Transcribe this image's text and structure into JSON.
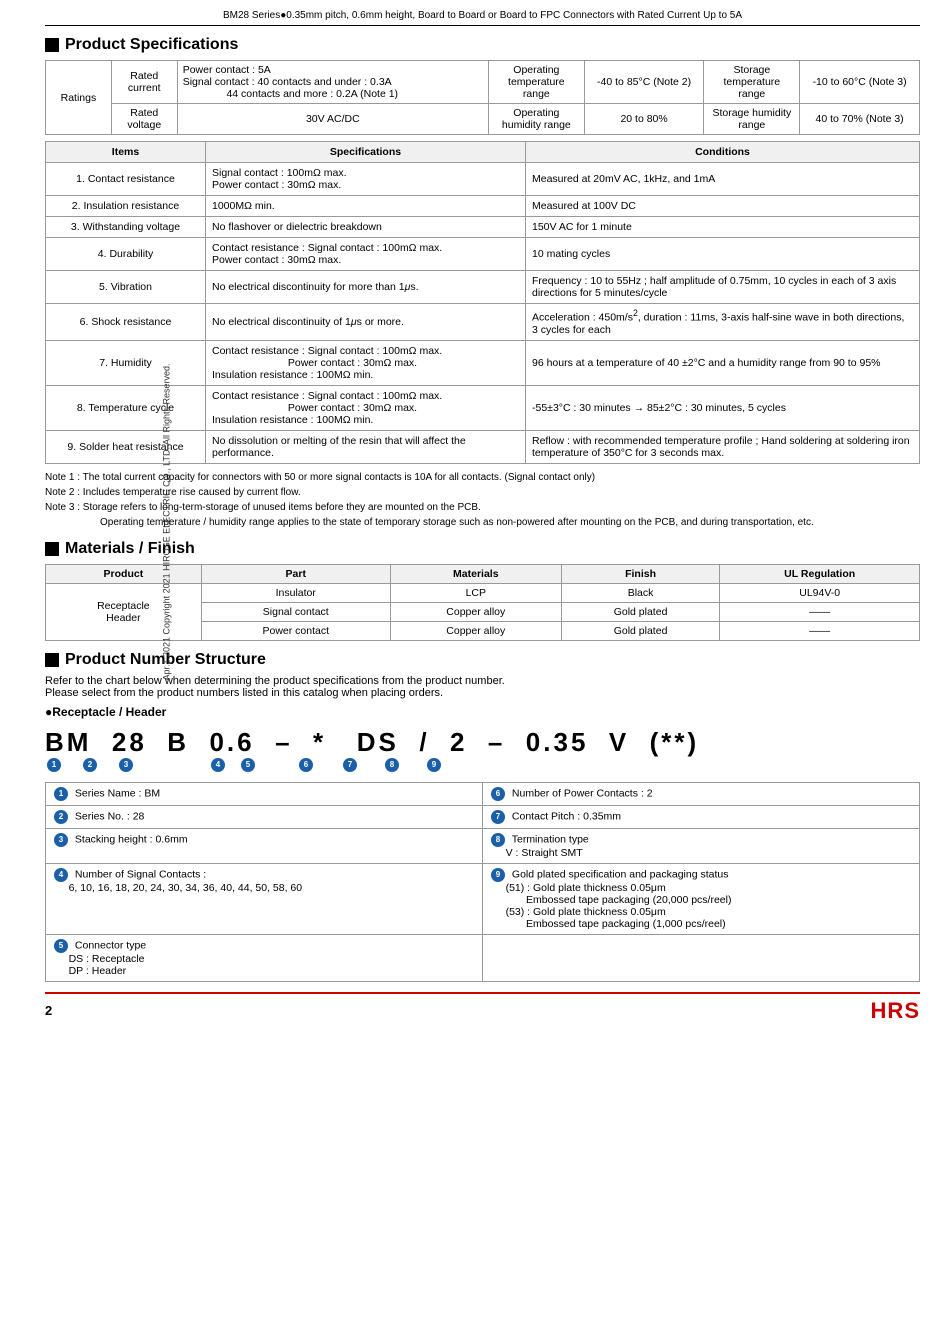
{
  "header": {
    "title": "BM28 Series●0.35mm pitch, 0.6mm height, Board to Board or Board to FPC Connectors with Rated Current Up to 5A"
  },
  "side_text": "Apr.1.2021 Copyright 2021 HIROSE ELECTRIC CO., LTD. All Rights Reserved.",
  "product_specs": {
    "title": "Product Specifications",
    "ratings_table": {
      "headers": [
        "Ratings",
        "Rated current",
        "Power contact : 5A / Signal contact : 40 contacts and under : 0.3A / 44 contacts and more : 0.2A (Note 1)",
        "Operating temperature range",
        "-40 to 85°C (Note 2)",
        "Storage temperature range",
        "-10 to 60°C (Note 3)"
      ],
      "row2": [
        "",
        "Rated voltage",
        "30V AC/DC",
        "Operating humidity range",
        "20 to 80%",
        "Storage humidity range",
        "40 to 70% (Note 3)"
      ]
    },
    "main_table": {
      "col_headers": [
        "Items",
        "Specifications",
        "Conditions"
      ],
      "rows": [
        {
          "item": "1. Contact resistance",
          "spec": "Signal contact : 100mΩ max.\nPower contact : 30mΩ max.",
          "cond": "Measured at 20mV AC, 1kHz, and 1mA"
        },
        {
          "item": "2. Insulation resistance",
          "spec": "1000MΩ min.",
          "cond": "Measured at 100V DC"
        },
        {
          "item": "3. Withstanding voltage",
          "spec": "No flashover or dielectric breakdown",
          "cond": "150V AC for 1 minute"
        },
        {
          "item": "4. Durability",
          "spec": "Contact resistance : Signal contact : 100mΩ max.\nPower contact : 30mΩ max.",
          "cond": "10 mating cycles"
        },
        {
          "item": "5. Vibration",
          "spec": "No electrical discontinuity for more than 1μs.",
          "cond": "Frequency : 10 to 55Hz ; half amplitude of 0.75mm, 10 cycles in each of 3 axis directions for 5 minutes/cycle"
        },
        {
          "item": "6. Shock resistance",
          "spec": "No electrical discontinuity of 1μs or more.",
          "cond": "Acceleration : 450m/s², duration : 11ms, 3-axis half-sine wave in both directions, 3 cycles for each"
        },
        {
          "item": "7. Humidity",
          "spec": "Contact resistance : Signal contact : 100mΩ max.\nPower contact : 30mΩ max.\nInsulation resistance : 100MΩ min.",
          "cond": "96 hours at a temperature of 40 ±2°C and a humidity range from 90 to 95%"
        },
        {
          "item": "8. Temperature cycle",
          "spec": "Contact resistance : Signal contact : 100mΩ max.\nPower contact : 30mΩ max.\nInsulation resistance : 100MΩ min.",
          "cond": "-55±3°C : 30 minutes → 85±2°C : 30 minutes, 5 cycles"
        },
        {
          "item": "9. Solder heat resistance",
          "spec": "No dissolution or melting of the resin that will affect the performance.",
          "cond": "Reflow : with recommended temperature profile ; Hand soldering at soldering iron temperature of 350°C for 3 seconds max."
        }
      ]
    },
    "notes": [
      "Note 1 : The total current capacity for connectors with 50 or more signal contacts is 10A for all contacts. (Signal contact only)",
      "Note 2 : Includes temperature rise caused by current flow.",
      "Note 3 : Storage refers to long-term-storage of unused items before they are mounted on the PCB.",
      "          Operating temperature / humidity range applies to the state of temporary storage such as non-powered after mounting on the PCB, and during transportation, etc."
    ]
  },
  "materials": {
    "title": "Materials / Finish",
    "table": {
      "headers": [
        "Product",
        "Part",
        "Materials",
        "Finish",
        "UL Regulation"
      ],
      "product": "Receptacle\nHeader",
      "rows": [
        {
          "part": "Insulator",
          "material": "LCP",
          "finish": "Black",
          "ul": "UL94V-0"
        },
        {
          "part": "Signal contact",
          "material": "Copper alloy",
          "finish": "Gold plated",
          "ul": "——"
        },
        {
          "part": "Power contact",
          "material": "Copper alloy",
          "finish": "Gold plated",
          "ul": "——"
        }
      ]
    }
  },
  "product_number": {
    "title": "Product Number Structure",
    "intro1": "Refer to the chart below when determining the product specifications from the product number.",
    "intro2": "Please select from the product numbers listed in this catalog when placing orders.",
    "sub_title": "●Receptacle / Header",
    "pn_display": "BM 28 B 0.6 – * DS / 2 – 0.35 V (**)",
    "pn_chars": [
      "BM",
      "28",
      "B",
      "0.6",
      "–",
      "*",
      "DS",
      "/",
      "2",
      "–",
      "0.35",
      "V",
      "(**)"
    ],
    "pn_nums": [
      "①",
      "②",
      "③",
      "",
      "④",
      "⑤",
      "",
      "",
      "⑥",
      "⑦",
      "⑧",
      "⑨"
    ],
    "num_positions": [
      0,
      1,
      2,
      4,
      5,
      8,
      9,
      10,
      11,
      12
    ],
    "explanations": [
      {
        "num": "①",
        "label": "Series Name : BM",
        "right_num": "⑥",
        "right_label": "Number of Power Contacts : 2"
      },
      {
        "num": "②",
        "label": "Series No. : 28",
        "right_num": "⑦",
        "right_label": "Contact Pitch : 0.35mm"
      },
      {
        "num": "③",
        "label": "Stacking height : 0.6mm",
        "right_num": "⑧",
        "right_label": "Termination type\nV : Straight SMT"
      },
      {
        "num": "④",
        "label": "Number of Signal Contacts :\n6, 10, 16, 18, 20, 24, 30, 34, 36, 40, 44, 50, 58, 60",
        "right_num": "⑨",
        "right_label": "Gold plated specification and packaging status\n(51) : Gold plate thickness 0.05μm\n       Embossed tape packaging (20,000 pcs/reel)\n(53) : Gold plate thickness 0.05μm\n       Embossed tape packaging (1,000 pcs/reel)"
      },
      {
        "num": "⑤",
        "label": "Connector type\nDS : Receptacle\nDP : Header",
        "right_num": "",
        "right_label": ""
      }
    ]
  },
  "footer": {
    "page_num": "2",
    "logo": "HRS"
  }
}
